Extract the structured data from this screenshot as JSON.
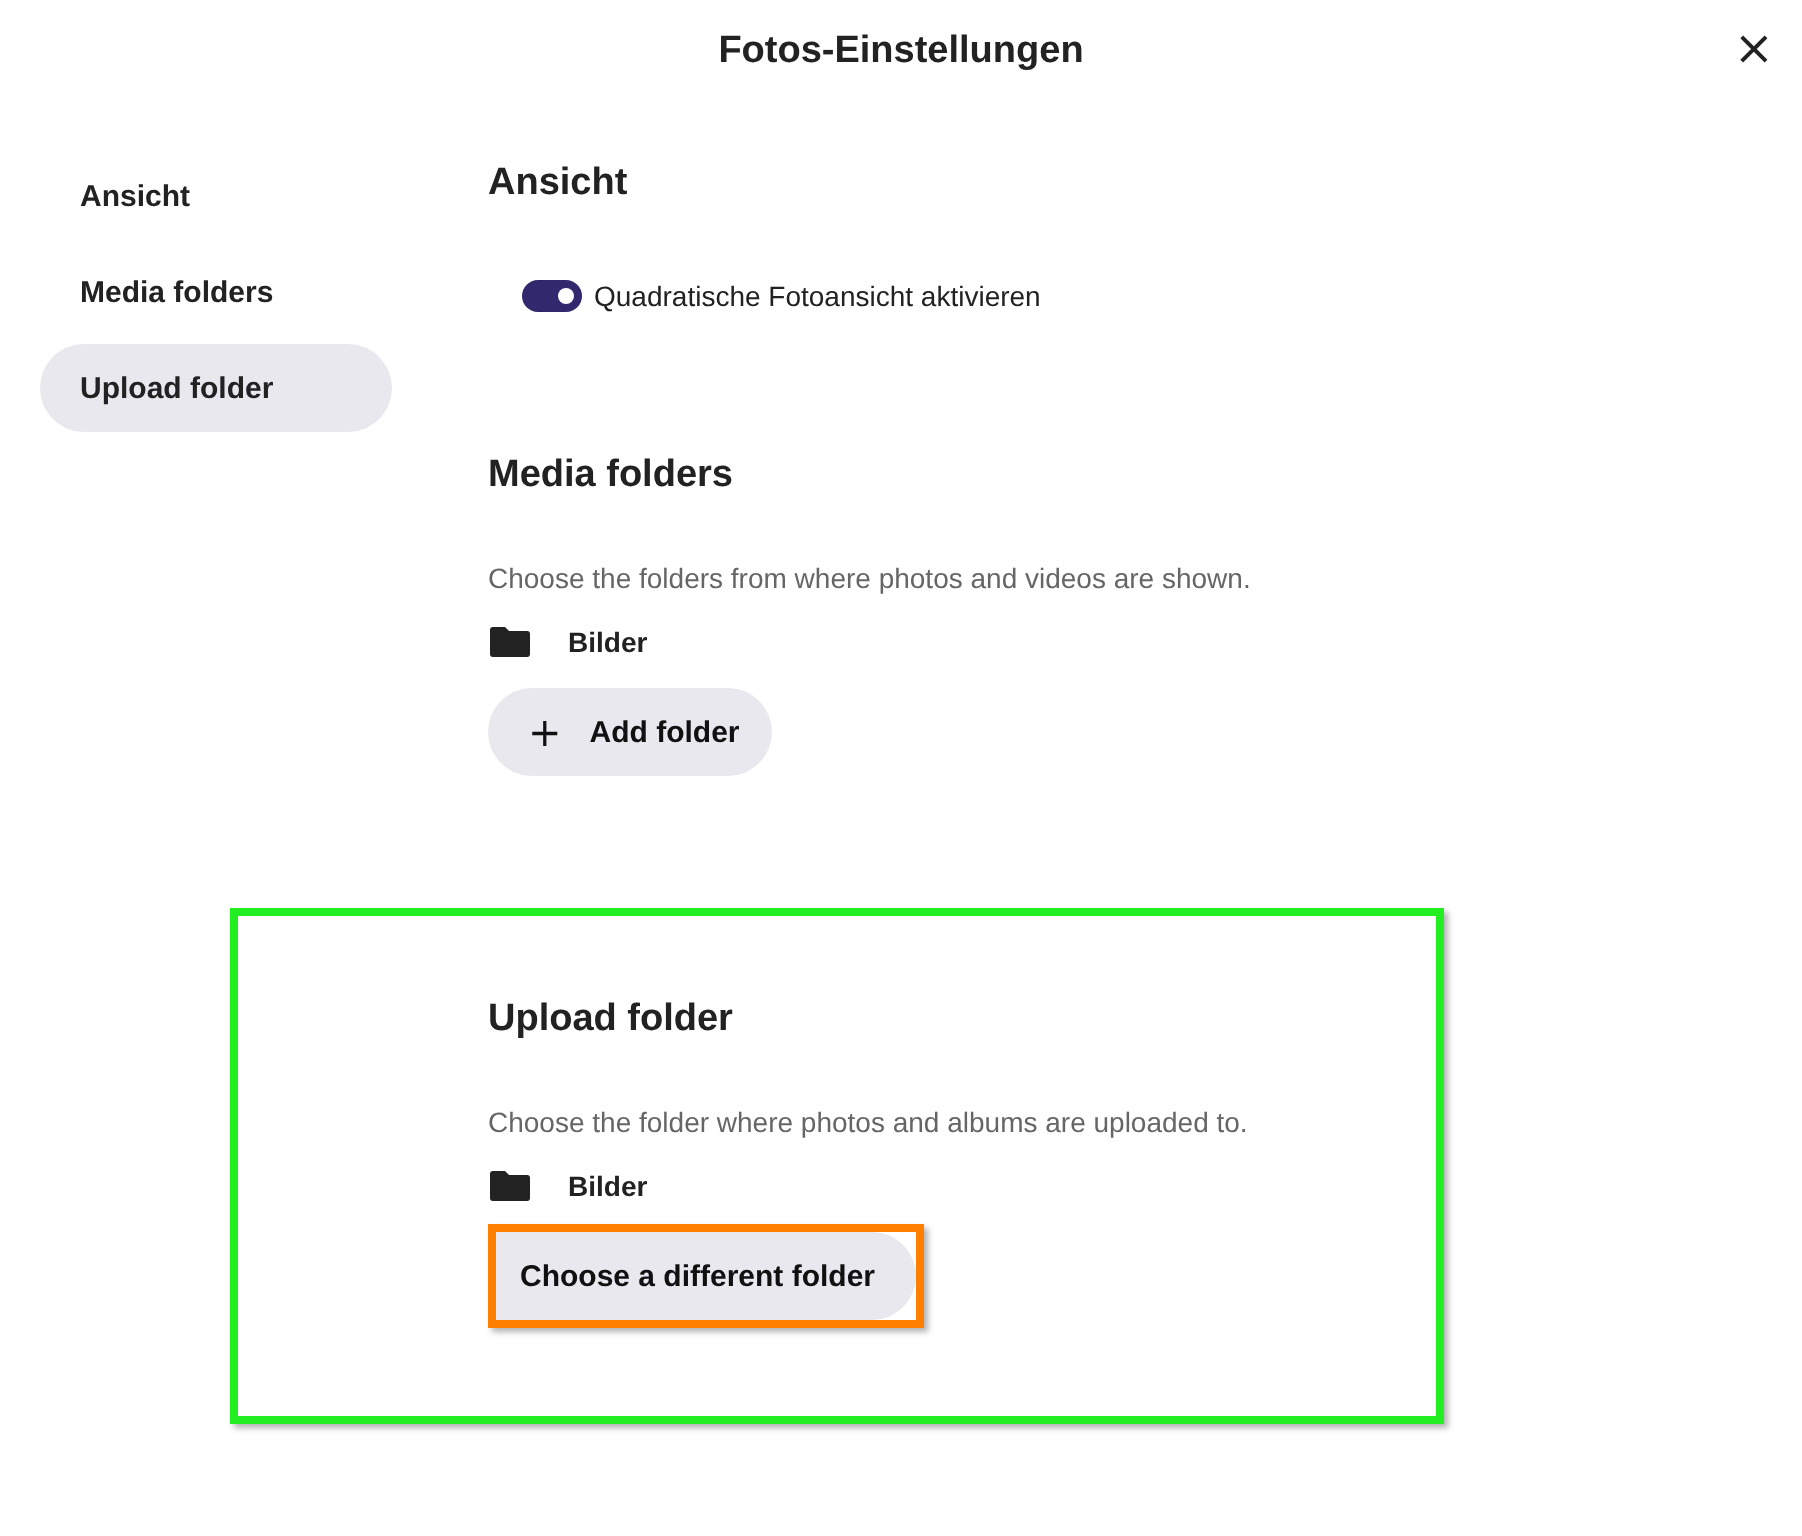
{
  "dialog": {
    "title": "Fotos-Einstellungen",
    "close": "×"
  },
  "sidebar": {
    "items": [
      {
        "label": "Ansicht",
        "selected": false
      },
      {
        "label": "Media folders",
        "selected": false
      },
      {
        "label": "Upload folder",
        "selected": true
      }
    ]
  },
  "sections": [
    {
      "kind": "toggles",
      "heading": "Ansicht",
      "highlighted": false,
      "toggles": [
        {
          "label": "Quadratische Fotoansicht aktivieren",
          "on": true
        }
      ]
    },
    {
      "kind": "folders",
      "heading": "Media folders",
      "highlighted": false,
      "description": "Choose the folders from where photos and videos are shown.",
      "folders": [
        "Bilder"
      ],
      "button": {
        "label": "Add folder",
        "icon": "+",
        "highlighted": false
      }
    },
    {
      "kind": "folders",
      "heading": "Upload folder",
      "highlighted": true,
      "description": "Choose the folder where photos and albums are uploaded to.",
      "folders": [
        "Bilder"
      ],
      "button": {
        "label": "Choose a different folder",
        "highlighted": true
      }
    }
  ]
}
